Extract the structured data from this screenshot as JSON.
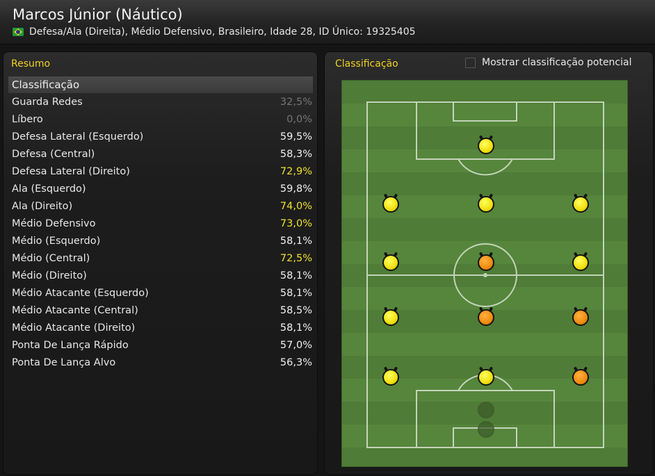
{
  "header": {
    "name": "Marcos Júnior (Náutico)",
    "info": "Defesa/Ala (Direita), Médio Defensivo, Brasileiro, Idade 28, ID Único: 19325405",
    "flag_icon": "brazil-flag-icon"
  },
  "summary": {
    "title": "Resumo",
    "header": "Classificação",
    "rows": [
      {
        "label": "Guarda Redes",
        "value": "32,5%",
        "style": "dim"
      },
      {
        "label": "Líbero",
        "value": "0,0%",
        "style": "dim"
      },
      {
        "label": "Defesa Lateral (Esquerdo)",
        "value": "59,5%",
        "style": "normal"
      },
      {
        "label": "Defesa (Central)",
        "value": "58,3%",
        "style": "normal"
      },
      {
        "label": "Defesa Lateral (Direito)",
        "value": "72,9%",
        "style": "highlight"
      },
      {
        "label": "Ala (Esquerdo)",
        "value": "59,8%",
        "style": "normal"
      },
      {
        "label": "Ala (Direito)",
        "value": "74,0%",
        "style": "highlight"
      },
      {
        "label": "Médio Defensivo",
        "value": "73,0%",
        "style": "highlight"
      },
      {
        "label": "Médio (Esquerdo)",
        "value": "58,1%",
        "style": "normal"
      },
      {
        "label": "Médio (Central)",
        "value": "72,5%",
        "style": "highlight"
      },
      {
        "label": "Médio (Direito)",
        "value": "58,1%",
        "style": "normal"
      },
      {
        "label": "Médio Atacante (Esquerdo)",
        "value": "58,1%",
        "style": "normal"
      },
      {
        "label": "Médio Atacante (Central)",
        "value": "58,5%",
        "style": "normal"
      },
      {
        "label": "Médio Atacante (Direito)",
        "value": "58,1%",
        "style": "normal"
      },
      {
        "label": "Ponta De Lança Rápido",
        "value": "57,0%",
        "style": "normal"
      },
      {
        "label": "Ponta De Lança Alvo",
        "value": "56,3%",
        "style": "normal"
      }
    ]
  },
  "classification": {
    "title": "Classificação",
    "show_potential_label": "Mostrar classificação potencial",
    "show_potential_checked": false,
    "positions": [
      {
        "role": "striker",
        "color": "yellow"
      },
      {
        "role": "attacking-mid-left",
        "color": "yellow"
      },
      {
        "role": "attacking-mid-center",
        "color": "yellow"
      },
      {
        "role": "attacking-mid-right",
        "color": "yellow"
      },
      {
        "role": "mid-left",
        "color": "yellow"
      },
      {
        "role": "mid-center",
        "color": "orange"
      },
      {
        "role": "mid-right",
        "color": "yellow"
      },
      {
        "role": "defensive-mid-left",
        "color": "yellow"
      },
      {
        "role": "defensive-mid-center",
        "color": "orange"
      },
      {
        "role": "defensive-mid-right",
        "color": "orange"
      },
      {
        "role": "defender-left",
        "color": "yellow"
      },
      {
        "role": "defender-center",
        "color": "yellow"
      },
      {
        "role": "defender-right",
        "color": "orange"
      },
      {
        "role": "libero",
        "color": "ghost"
      },
      {
        "role": "goalkeeper",
        "color": "ghost"
      }
    ]
  },
  "colors": {
    "accent_yellow": "#f0d020",
    "highlight_value": "#f0e030",
    "dim_value": "#767676",
    "pitch_green": "#4f7c37"
  }
}
